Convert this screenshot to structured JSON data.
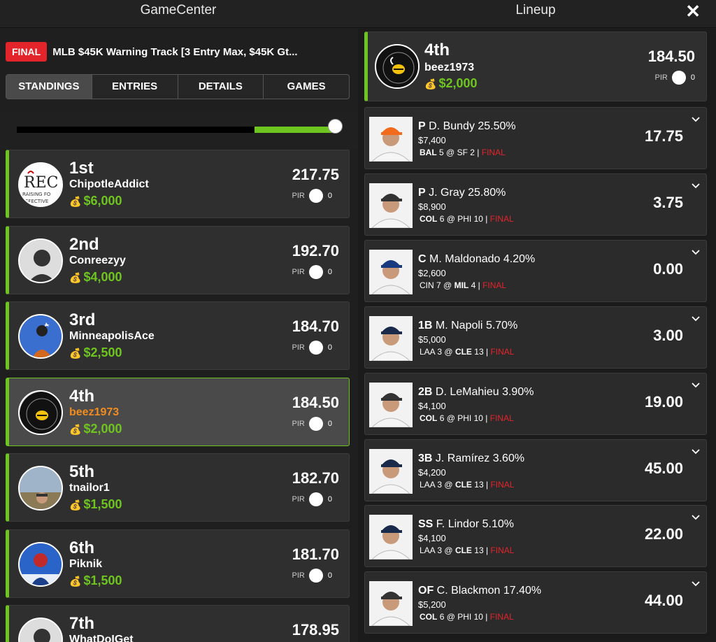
{
  "header": {
    "left_title": "GameCenter",
    "right_title": "Lineup",
    "close_label": "✕"
  },
  "contest": {
    "badge": "FINAL",
    "name": "MLB $45K Warning Track [3 Entry Max, $45K Gt..."
  },
  "tabs": [
    {
      "label": "STANDINGS",
      "active": true
    },
    {
      "label": "ENTRIES",
      "active": false
    },
    {
      "label": "DETAILS",
      "active": false
    },
    {
      "label": "GAMES",
      "active": false
    }
  ],
  "slider": {
    "fill_fraction": 0.26
  },
  "standings": [
    {
      "rank": "1st",
      "user": "ChipotleAddict",
      "prize": "$6,000",
      "score": "217.75",
      "pir_label": "PIR",
      "pir": "0"
    },
    {
      "rank": "2nd",
      "user": "Conreezyy",
      "prize": "$4,000",
      "score": "192.70",
      "pir_label": "PIR",
      "pir": "0"
    },
    {
      "rank": "3rd",
      "user": "MinneapolisAce",
      "prize": "$2,500",
      "score": "184.70",
      "pir_label": "PIR",
      "pir": "0"
    },
    {
      "rank": "4th",
      "user": "beez1973",
      "prize": "$2,000",
      "score": "184.50",
      "pir_label": "PIR",
      "pir": "0"
    },
    {
      "rank": "5th",
      "user": "tnailor1",
      "prize": "$1,500",
      "score": "182.70",
      "pir_label": "PIR",
      "pir": "0"
    },
    {
      "rank": "6th",
      "user": "Piknik",
      "prize": "$1,500",
      "score": "181.70",
      "pir_label": "PIR",
      "pir": "0"
    },
    {
      "rank": "7th",
      "user": "WhatDoIGet",
      "prize": "",
      "score": "178.95",
      "pir_label": "PIR",
      "pir": "0"
    }
  ],
  "lineup": {
    "rank": "4th",
    "user": "beez1973",
    "prize": "$2,000",
    "score": "184.50",
    "pir_label": "PIR",
    "pir": "0",
    "players": [
      {
        "pos": "P",
        "name": "D. Bundy",
        "own": "25.50%",
        "salary": "$7,400",
        "away": "BAL",
        "away_score": "5",
        "at": "@",
        "home": "SF",
        "home_score": "2",
        "status": "FINAL",
        "bold_team": "away",
        "pts": "17.75"
      },
      {
        "pos": "P",
        "name": "J. Gray",
        "own": "25.80%",
        "salary": "$8,900",
        "away": "COL",
        "away_score": "6",
        "at": "@",
        "home": "PHI",
        "home_score": "10",
        "status": "FINAL",
        "bold_team": "away",
        "pts": "3.75"
      },
      {
        "pos": "C",
        "name": "M. Maldonado",
        "own": "4.20%",
        "salary": "$2,600",
        "away": "CIN",
        "away_score": "7",
        "at": "@",
        "home": "MIL",
        "home_score": "4",
        "status": "FINAL",
        "bold_team": "home",
        "pts": "0.00"
      },
      {
        "pos": "1B",
        "name": "M. Napoli",
        "own": "5.70%",
        "salary": "$5,000",
        "away": "LAA",
        "away_score": "3",
        "at": "@",
        "home": "CLE",
        "home_score": "13",
        "status": "FINAL",
        "bold_team": "home",
        "pts": "3.00"
      },
      {
        "pos": "2B",
        "name": "D. LeMahieu",
        "own": "3.90%",
        "salary": "$4,100",
        "away": "COL",
        "away_score": "6",
        "at": "@",
        "home": "PHI",
        "home_score": "10",
        "status": "FINAL",
        "bold_team": "away",
        "pts": "19.00"
      },
      {
        "pos": "3B",
        "name": "J. Ramírez",
        "own": "3.60%",
        "salary": "$4,200",
        "away": "LAA",
        "away_score": "3",
        "at": "@",
        "home": "CLE",
        "home_score": "13",
        "status": "FINAL",
        "bold_team": "home",
        "pts": "45.00"
      },
      {
        "pos": "SS",
        "name": "F. Lindor",
        "own": "5.10%",
        "salary": "$4,100",
        "away": "LAA",
        "away_score": "3",
        "at": "@",
        "home": "CLE",
        "home_score": "13",
        "status": "FINAL",
        "bold_team": "home",
        "pts": "22.00"
      },
      {
        "pos": "OF",
        "name": "C. Blackmon",
        "own": "17.40%",
        "salary": "$5,200",
        "away": "COL",
        "away_score": "6",
        "at": "@",
        "home": "PHI",
        "home_score": "10",
        "status": "FINAL",
        "bold_team": "away",
        "pts": "44.00"
      }
    ]
  },
  "colors": {
    "accent_green": "#6fc51f",
    "final_red": "#e3242b",
    "me_orange": "#f28c1e"
  }
}
